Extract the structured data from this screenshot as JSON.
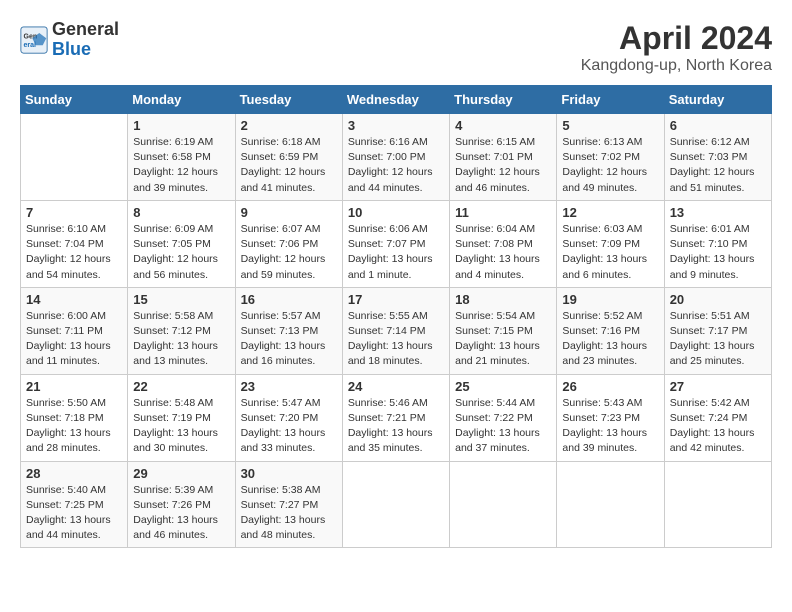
{
  "header": {
    "logo": {
      "general": "General",
      "blue": "Blue"
    },
    "title": "April 2024",
    "subtitle": "Kangdong-up, North Korea"
  },
  "columns": [
    "Sunday",
    "Monday",
    "Tuesday",
    "Wednesday",
    "Thursday",
    "Friday",
    "Saturday"
  ],
  "weeks": [
    [
      {
        "day": "",
        "info": ""
      },
      {
        "day": "1",
        "info": "Sunrise: 6:19 AM\nSunset: 6:58 PM\nDaylight: 12 hours\nand 39 minutes."
      },
      {
        "day": "2",
        "info": "Sunrise: 6:18 AM\nSunset: 6:59 PM\nDaylight: 12 hours\nand 41 minutes."
      },
      {
        "day": "3",
        "info": "Sunrise: 6:16 AM\nSunset: 7:00 PM\nDaylight: 12 hours\nand 44 minutes."
      },
      {
        "day": "4",
        "info": "Sunrise: 6:15 AM\nSunset: 7:01 PM\nDaylight: 12 hours\nand 46 minutes."
      },
      {
        "day": "5",
        "info": "Sunrise: 6:13 AM\nSunset: 7:02 PM\nDaylight: 12 hours\nand 49 minutes."
      },
      {
        "day": "6",
        "info": "Sunrise: 6:12 AM\nSunset: 7:03 PM\nDaylight: 12 hours\nand 51 minutes."
      }
    ],
    [
      {
        "day": "7",
        "info": "Sunrise: 6:10 AM\nSunset: 7:04 PM\nDaylight: 12 hours\nand 54 minutes."
      },
      {
        "day": "8",
        "info": "Sunrise: 6:09 AM\nSunset: 7:05 PM\nDaylight: 12 hours\nand 56 minutes."
      },
      {
        "day": "9",
        "info": "Sunrise: 6:07 AM\nSunset: 7:06 PM\nDaylight: 12 hours\nand 59 minutes."
      },
      {
        "day": "10",
        "info": "Sunrise: 6:06 AM\nSunset: 7:07 PM\nDaylight: 13 hours\nand 1 minute."
      },
      {
        "day": "11",
        "info": "Sunrise: 6:04 AM\nSunset: 7:08 PM\nDaylight: 13 hours\nand 4 minutes."
      },
      {
        "day": "12",
        "info": "Sunrise: 6:03 AM\nSunset: 7:09 PM\nDaylight: 13 hours\nand 6 minutes."
      },
      {
        "day": "13",
        "info": "Sunrise: 6:01 AM\nSunset: 7:10 PM\nDaylight: 13 hours\nand 9 minutes."
      }
    ],
    [
      {
        "day": "14",
        "info": "Sunrise: 6:00 AM\nSunset: 7:11 PM\nDaylight: 13 hours\nand 11 minutes."
      },
      {
        "day": "15",
        "info": "Sunrise: 5:58 AM\nSunset: 7:12 PM\nDaylight: 13 hours\nand 13 minutes."
      },
      {
        "day": "16",
        "info": "Sunrise: 5:57 AM\nSunset: 7:13 PM\nDaylight: 13 hours\nand 16 minutes."
      },
      {
        "day": "17",
        "info": "Sunrise: 5:55 AM\nSunset: 7:14 PM\nDaylight: 13 hours\nand 18 minutes."
      },
      {
        "day": "18",
        "info": "Sunrise: 5:54 AM\nSunset: 7:15 PM\nDaylight: 13 hours\nand 21 minutes."
      },
      {
        "day": "19",
        "info": "Sunrise: 5:52 AM\nSunset: 7:16 PM\nDaylight: 13 hours\nand 23 minutes."
      },
      {
        "day": "20",
        "info": "Sunrise: 5:51 AM\nSunset: 7:17 PM\nDaylight: 13 hours\nand 25 minutes."
      }
    ],
    [
      {
        "day": "21",
        "info": "Sunrise: 5:50 AM\nSunset: 7:18 PM\nDaylight: 13 hours\nand 28 minutes."
      },
      {
        "day": "22",
        "info": "Sunrise: 5:48 AM\nSunset: 7:19 PM\nDaylight: 13 hours\nand 30 minutes."
      },
      {
        "day": "23",
        "info": "Sunrise: 5:47 AM\nSunset: 7:20 PM\nDaylight: 13 hours\nand 33 minutes."
      },
      {
        "day": "24",
        "info": "Sunrise: 5:46 AM\nSunset: 7:21 PM\nDaylight: 13 hours\nand 35 minutes."
      },
      {
        "day": "25",
        "info": "Sunrise: 5:44 AM\nSunset: 7:22 PM\nDaylight: 13 hours\nand 37 minutes."
      },
      {
        "day": "26",
        "info": "Sunrise: 5:43 AM\nSunset: 7:23 PM\nDaylight: 13 hours\nand 39 minutes."
      },
      {
        "day": "27",
        "info": "Sunrise: 5:42 AM\nSunset: 7:24 PM\nDaylight: 13 hours\nand 42 minutes."
      }
    ],
    [
      {
        "day": "28",
        "info": "Sunrise: 5:40 AM\nSunset: 7:25 PM\nDaylight: 13 hours\nand 44 minutes."
      },
      {
        "day": "29",
        "info": "Sunrise: 5:39 AM\nSunset: 7:26 PM\nDaylight: 13 hours\nand 46 minutes."
      },
      {
        "day": "30",
        "info": "Sunrise: 5:38 AM\nSunset: 7:27 PM\nDaylight: 13 hours\nand 48 minutes."
      },
      {
        "day": "",
        "info": ""
      },
      {
        "day": "",
        "info": ""
      },
      {
        "day": "",
        "info": ""
      },
      {
        "day": "",
        "info": ""
      }
    ]
  ]
}
